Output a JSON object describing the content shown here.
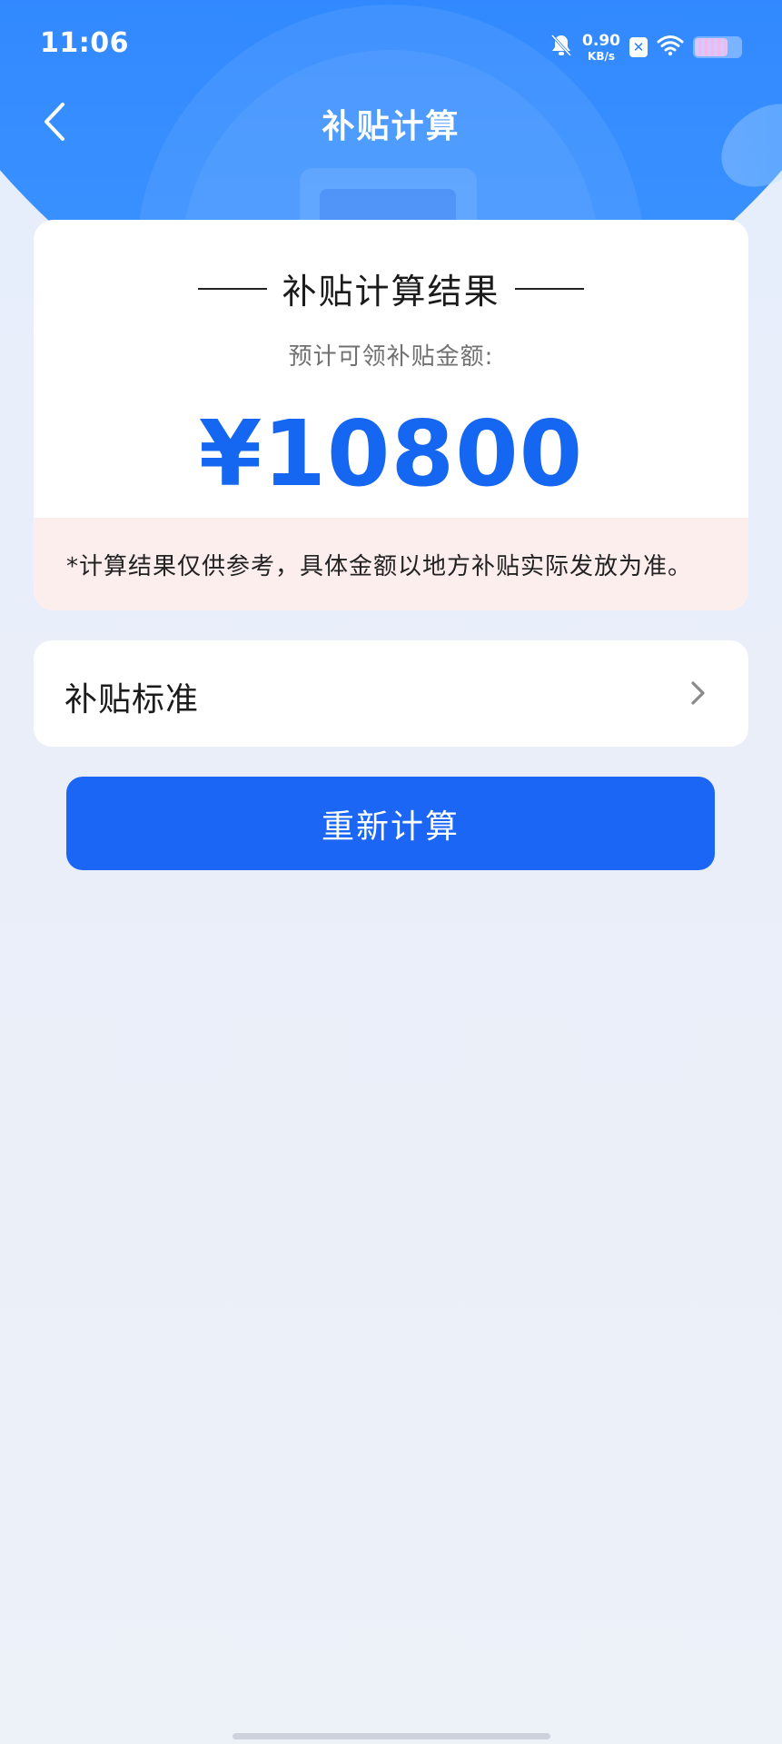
{
  "status_bar": {
    "time": "11:06",
    "net_speed_value": "0.90",
    "net_speed_unit": "KB/s",
    "icons": [
      "mute-bell-icon",
      "box-x-icon",
      "wifi-icon",
      "battery-icon"
    ]
  },
  "header": {
    "title": "补贴计算",
    "back_icon": "chevron-left-icon"
  },
  "result": {
    "title": "补贴计算结果",
    "subtitle": "预计可领补贴金额:",
    "amount": "¥10800",
    "note": "*计算结果仅供参考，具体金额以地方补贴实际发放为准。"
  },
  "standard": {
    "label": "补贴标准",
    "icon": "chevron-right-icon"
  },
  "actions": {
    "recalc_label": "重新计算"
  },
  "colors": {
    "brand_blue": "#1b66f5",
    "amount_blue": "#1566f0",
    "note_bg": "#fdeeee"
  }
}
